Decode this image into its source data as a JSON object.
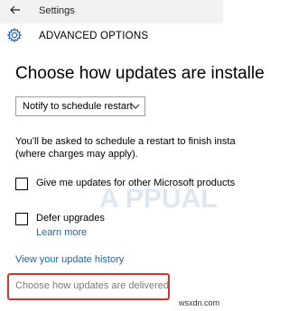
{
  "titlebar": {
    "back_icon": "arrow-left-icon",
    "title": "Settings"
  },
  "header": {
    "icon": "gear-icon",
    "title": "ADVANCED OPTIONS"
  },
  "section": {
    "heading": "Choose how updates are installe"
  },
  "dropdown": {
    "value": "Notify to schedule restart"
  },
  "description": {
    "line1": "You’ll be asked to schedule a restart to finish insta",
    "line2": "(where charges may apply)."
  },
  "options": {
    "microsoft_products": {
      "label": "Give me updates for other Microsoft products",
      "checked": false
    },
    "defer_upgrades": {
      "label": "Defer upgrades",
      "checked": false
    }
  },
  "links": {
    "learn_more": "Learn more",
    "update_history": "View your update history"
  },
  "delivery": {
    "label": "Choose how updates are delivered"
  },
  "watermark": {
    "site": "wsxdn.com",
    "logo": "A PPUALS"
  },
  "colors": {
    "link": "#1a63b0",
    "highlight": "#d9312a"
  }
}
